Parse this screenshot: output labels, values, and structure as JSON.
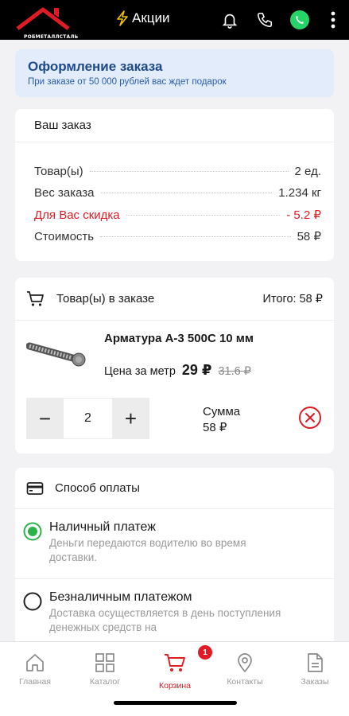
{
  "header": {
    "logo_text": "РОБМЕТАЛЛСТАЛЬ",
    "promo_label": "Акции",
    "icons": [
      "bell-icon",
      "phone-icon",
      "whatsapp-icon",
      "more-vertical-icon"
    ]
  },
  "banner": {
    "title": "Оформление заказа",
    "subtitle": "При заказе от 50 000 рублей вас ждет подарок"
  },
  "order_summary": {
    "title": "Ваш заказ",
    "rows": [
      {
        "label": "Товар(ы)",
        "value": "2 ед."
      },
      {
        "label": "Вес заказа",
        "value": "1.234 кг"
      },
      {
        "label": "Для Вас скидка",
        "value": "- 5.2 ₽"
      },
      {
        "label": "Стоимость",
        "value": "58 ₽"
      }
    ]
  },
  "items": {
    "title": "Товар(ы) в заказе",
    "total": "Итого: 58 ₽",
    "product": {
      "name": "Арматура А-3 500С 10 мм",
      "price_label": "Цена за метр",
      "price_now": "29 ₽",
      "price_old": "31.6 ₽",
      "quantity": "2",
      "minus": "−",
      "plus": "+",
      "sum_label": "Сумма",
      "sum_value": "58 ₽"
    }
  },
  "payment": {
    "title": "Способ оплаты",
    "options": [
      {
        "title": "Наличный платеж",
        "desc": "Деньги передаются водителю во время доставки.",
        "selected": true
      },
      {
        "title": "Безналичным платежом",
        "desc": "Доставка осуществляется в день поступления денежных средств на",
        "selected": false
      }
    ]
  },
  "nav": {
    "items": [
      {
        "label": "Главная",
        "icon": "home-icon"
      },
      {
        "label": "Каталог",
        "icon": "catalog-icon"
      },
      {
        "label": "Корзина",
        "icon": "cart-icon",
        "active": true,
        "badge": "1"
      },
      {
        "label": "Контакты",
        "icon": "location-icon"
      },
      {
        "label": "Заказы",
        "icon": "orders-icon"
      }
    ]
  },
  "colors": {
    "accent": "#e01b24",
    "banner_bg": "#e2ecfb",
    "radio_active": "#2bb34a",
    "whatsapp": "#25d366"
  }
}
